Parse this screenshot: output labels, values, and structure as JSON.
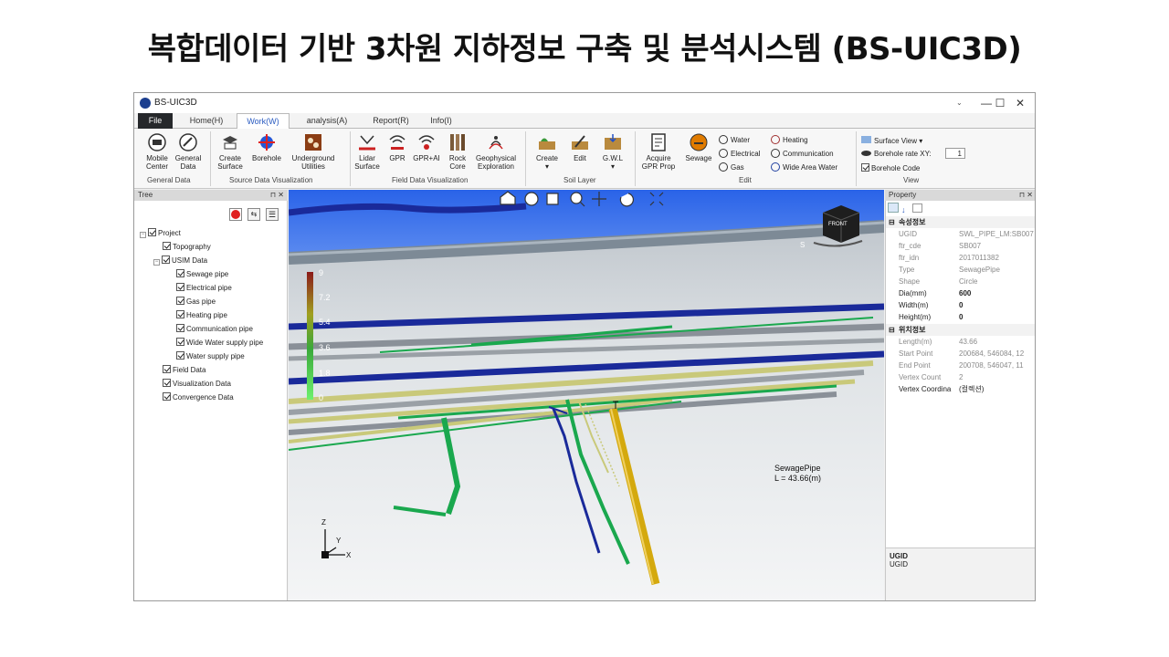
{
  "slide": {
    "title": "복합데이터 기반 3차원 지하정보 구축 및 분석시스템 (BS-UIC3D)"
  },
  "window": {
    "title": "BS-UIC3D",
    "minimize": "—",
    "maximize": "☐",
    "close": "✕"
  },
  "tabs": [
    {
      "label": "File"
    },
    {
      "label": "Home(H)"
    },
    {
      "label": "Work(W)"
    },
    {
      "label": "analysis(A)"
    },
    {
      "label": "Report(R)"
    },
    {
      "label": "Info(I)"
    }
  ],
  "ribbon": {
    "general": {
      "mobile_1": "Mobile",
      "mobile_2": "Center",
      "general_1": "General",
      "general_2": "Data",
      "label": "General Data"
    },
    "source": {
      "create_1": "Create",
      "create_2": "Surface",
      "borehole": "Borehole",
      "utilities_1": "Underground",
      "utilities_2": "Utilities",
      "label": "Source Data  Visualization"
    },
    "field": {
      "lidar_1": "Lidar",
      "lidar_2": "Surface",
      "gpr": "GPR",
      "gprai": "GPR+AI",
      "rock_1": "Rock",
      "rock_2": "Core",
      "geo_1": "Geophysical",
      "geo_2": "Exploration",
      "label": "Field Data Visualization"
    },
    "soil": {
      "create": "Create",
      "edit": "Edit",
      "gwl": "G.W.L",
      "label": "Soil Layer"
    },
    "edit": {
      "acquire_1": "Acquire",
      "acquire_2": "GPR Prop",
      "sewage": "Sewage",
      "water": "Water",
      "electrical": "Electrical",
      "gas": "Gas",
      "heating": "Heating",
      "communication": "Communication",
      "wide_area_water": "Wide Area Water",
      "label": "Edit"
    },
    "view": {
      "surface_view": "Surface View",
      "borehole_rate": "Borehole rate XY:",
      "borehole_rate_value": "1",
      "borehole_code": "Borehole Code",
      "label": "View"
    }
  },
  "tree_panel": {
    "header": "Tree",
    "items": [
      {
        "label": "Project"
      },
      {
        "label": "Topography"
      },
      {
        "label": "USIM Data"
      },
      {
        "label": "Sewage pipe"
      },
      {
        "label": "Electrical pipe"
      },
      {
        "label": "Gas pipe"
      },
      {
        "label": "Heating pipe"
      },
      {
        "label": "Communication pipe"
      },
      {
        "label": "Wide Water supply pipe"
      },
      {
        "label": "Water supply pipe"
      },
      {
        "label": "Field Data"
      },
      {
        "label": "Visualization Data"
      },
      {
        "label": "Convergence Data"
      }
    ]
  },
  "viewport": {
    "legend_ticks": [
      "9",
      "7.2",
      "5.4",
      "3.6",
      "1.8",
      "0"
    ],
    "pipe_label_1": "SewagePipe",
    "pipe_label_2": "L = 43.66(m)",
    "cube_label": "FRONT",
    "cube_s": "S",
    "axis_z": "Z",
    "axis_y": "Y",
    "axis_x": "X",
    "marker": "I"
  },
  "property_panel": {
    "header": "Property",
    "category1": "속성정보",
    "rows1": [
      {
        "key": "UGID",
        "value": "SWL_PIPE_LM:SB007"
      },
      {
        "key": "ftr_cde",
        "value": "SB007"
      },
      {
        "key": "ftr_idn",
        "value": "2017011382"
      },
      {
        "key": "Type",
        "value": "SewagePipe"
      },
      {
        "key": "Shape",
        "value": "Circle"
      },
      {
        "key": "Dia(mm)",
        "value": "600"
      },
      {
        "key": "Width(m)",
        "value": "0"
      },
      {
        "key": "Height(m)",
        "value": "0"
      }
    ],
    "category2": "위치정보",
    "rows2": [
      {
        "key": "Length(m)",
        "value": "43.66"
      },
      {
        "key": "Start Point",
        "value": "200684, 546084, 12"
      },
      {
        "key": "End Point",
        "value": "200708, 546047, 11"
      },
      {
        "key": "Vertex Count",
        "value": "2"
      },
      {
        "key": "Vertex Coordina",
        "value": "(컬렉션)"
      }
    ],
    "desc_title": "UGID",
    "desc_text": "UGID"
  },
  "colors": {
    "sky": "#2a63e8",
    "ground_gray": "#cfd4d8",
    "sewage": "#d4a90e",
    "water": "#2018b6",
    "communication": "#1aa84e",
    "gas": "#c9c97a"
  }
}
